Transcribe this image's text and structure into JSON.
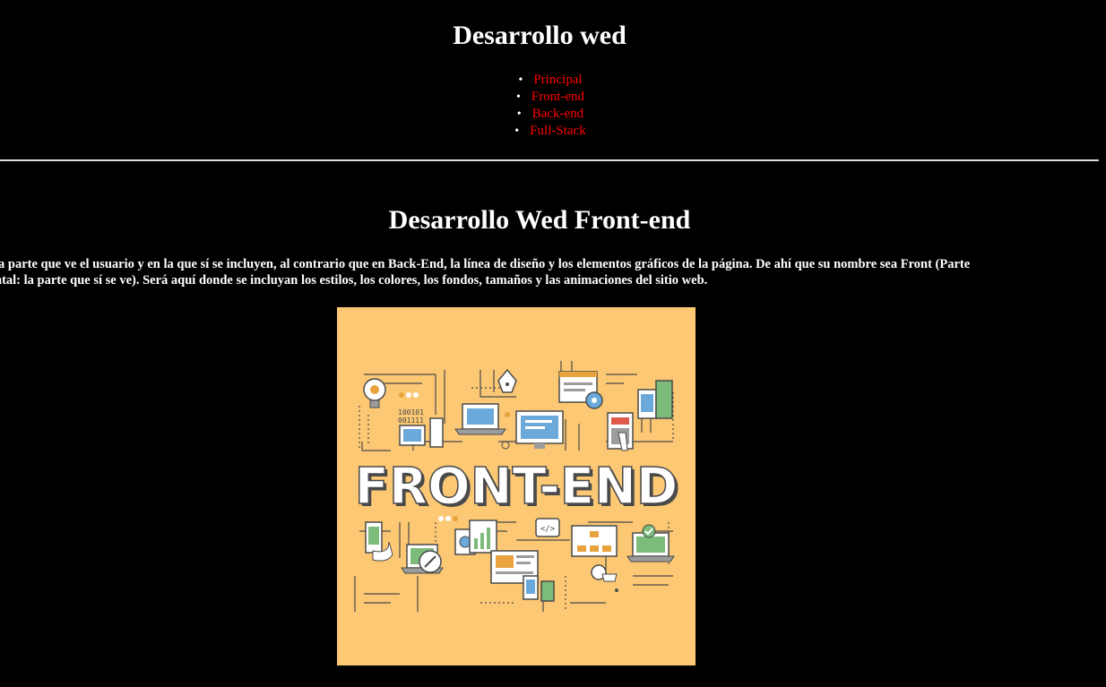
{
  "header": {
    "title": "Desarrollo wed"
  },
  "nav": {
    "items": [
      {
        "label": "Principal"
      },
      {
        "label": "Front-end"
      },
      {
        "label": "Back-end"
      },
      {
        "label": "Full-Stack"
      }
    ],
    "link_color": "#ff0000"
  },
  "section": {
    "title": "Desarrollo Wed Front-end",
    "paragraph_line_1": "la parte que ve el usuario y en la que sí se incluyen, al contrario que en Back-End, la línea de diseño y los elementos gráficos de la página. De ahí que su nombre sea Front (Parte",
    "paragraph_line_2": "ntal: la parte que sí se ve). Será aquí donde se incluyan los estilos, los colores, los fondos, tamaños y las animaciones del sitio web."
  },
  "hero_image": {
    "word": "FRONT-END",
    "binary_text_1": "100101",
    "binary_text_2": "001111",
    "code_icon_text": "</>",
    "background": "#fcc874"
  }
}
